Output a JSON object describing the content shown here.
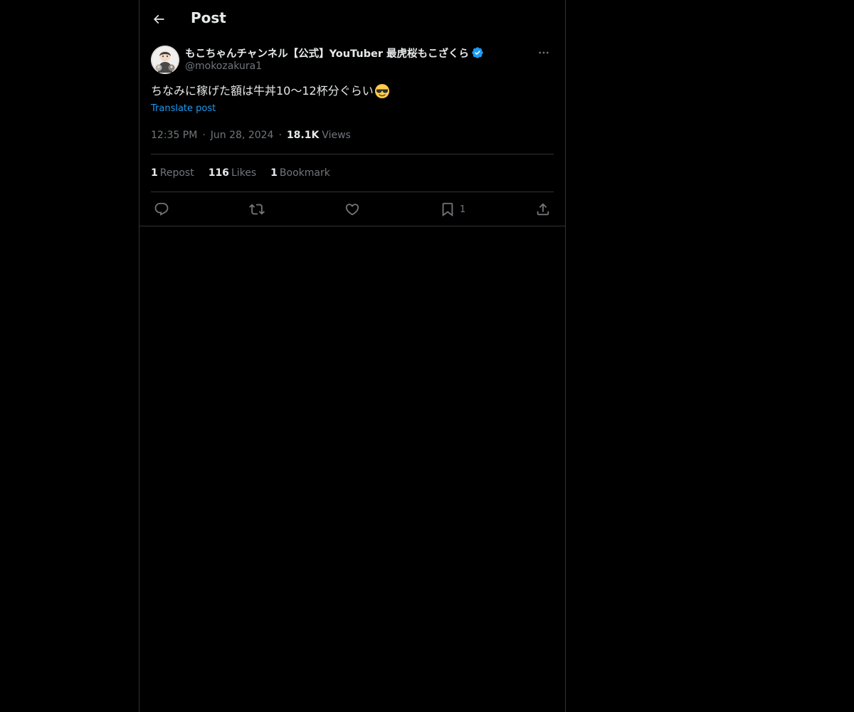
{
  "header": {
    "title": "Post"
  },
  "post": {
    "author_name": "もこちゃんチャンネル【公式】YouTuber 最虎桜もこざくら",
    "handle": "@mokozakura1",
    "text": "ちなみに稼げた額は牛丼10〜12杯分ぐらい",
    "translate_label": "Translate post",
    "time": "12:35 PM",
    "date": "Jun 28, 2024",
    "views_count": "18.1K",
    "views_label": "Views",
    "stats": {
      "reposts_count": "1",
      "reposts_label": "Repost",
      "likes_count": "116",
      "likes_label": "Likes",
      "bookmarks_count": "1",
      "bookmarks_label": "Bookmark"
    },
    "actions": {
      "bookmark_count": "1"
    }
  },
  "icons": {
    "back": "arrow-left-icon",
    "verified": "verified-badge-icon",
    "more": "more-horizontal-icon",
    "reply": "reply-icon",
    "repost": "repost-icon",
    "like": "heart-icon",
    "bookmark": "bookmark-icon",
    "share": "share-icon",
    "emoji": "sunglasses-emoji"
  },
  "colors": {
    "background": "#000000",
    "text": "#e7e9ea",
    "secondary": "#71767b",
    "accent": "#1d9bf0",
    "border": "#2f3336"
  }
}
